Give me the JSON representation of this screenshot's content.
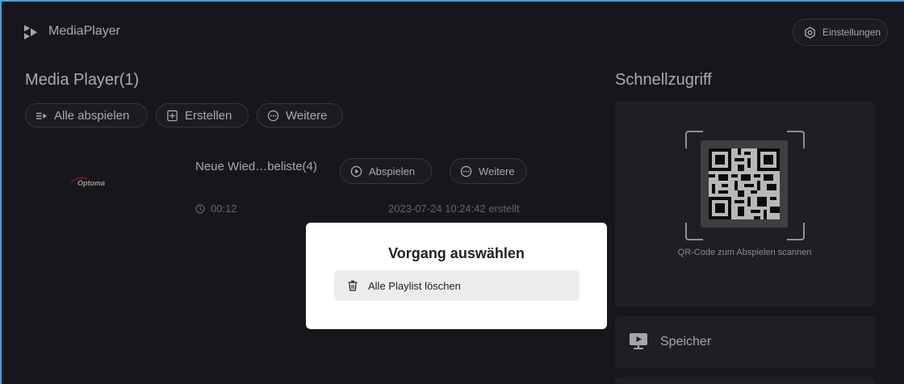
{
  "app": {
    "title": "MediaPlayer",
    "logo_icon": "mediaplayer-logo-icon",
    "settings_label": "Einstellungen",
    "settings_icon": "gear-icon"
  },
  "media_player": {
    "title": "Media Player(1)",
    "actions": {
      "play_all": "Alle abspielen",
      "create": "Erstellen",
      "more": "Weitere"
    },
    "playlist": {
      "thumbnail_text": "Optoma",
      "name": "Neue Wied…beliste(4)",
      "play_label": "Abspielen",
      "more_label": "Weitere",
      "duration": "00:12",
      "created": "2023-07-24 10:24:42 erstellt"
    }
  },
  "quick_access": {
    "title": "Schnellzugriff",
    "qr_caption": "QR-Code zum Abspielen scannen",
    "storage_label": "Speicher",
    "storage_icon": "storage-icon"
  },
  "dialog": {
    "title": "Vorgang auswählen",
    "item_label": "Alle Playlist löschen",
    "item_icon": "trash-icon"
  },
  "colors": {
    "background": "#202126",
    "panel": "#2a2b31",
    "accent_border": "#3fa6dc",
    "logo_red": "#c8102e"
  }
}
